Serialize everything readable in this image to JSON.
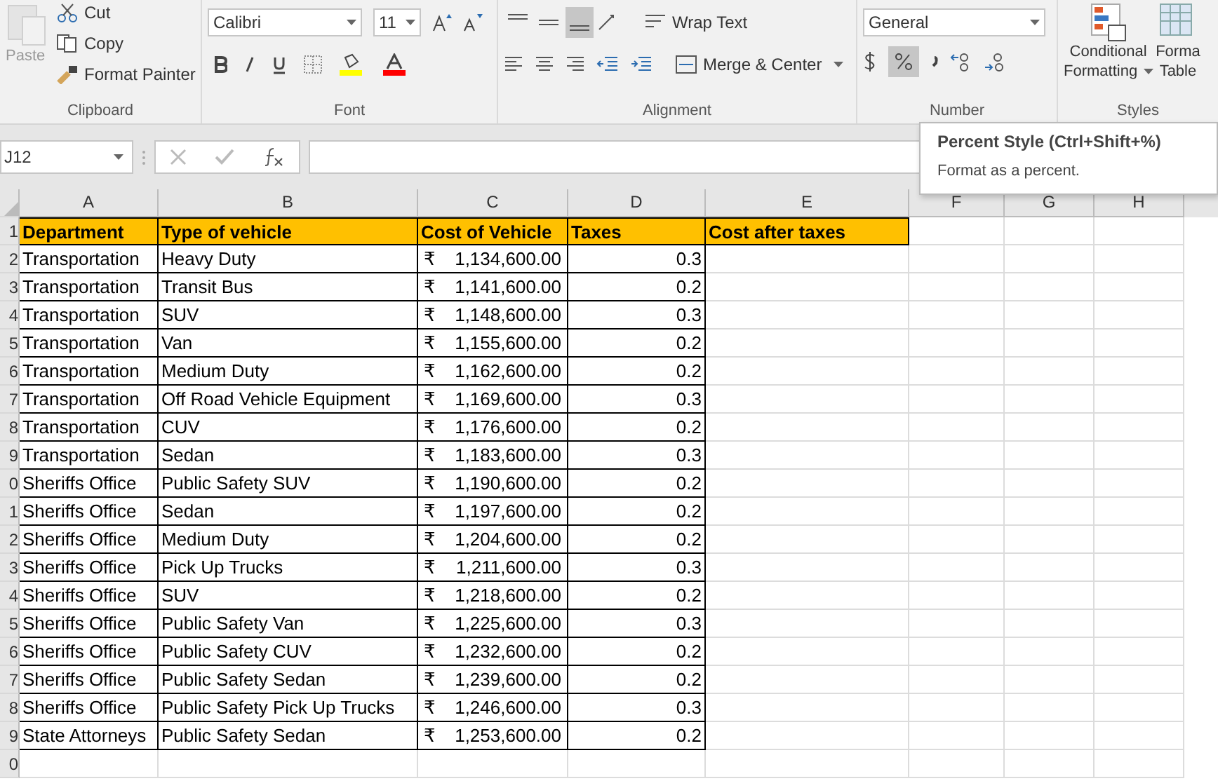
{
  "ribbon": {
    "clipboard": {
      "paste": "Paste",
      "cut": "Cut",
      "copy": "Copy",
      "format_painter": "Format Painter",
      "group_label": "Clipboard"
    },
    "font": {
      "font_name": "Calibri",
      "font_size": "11",
      "group_label": "Font"
    },
    "alignment": {
      "vertical_buttons": [
        {
          "selected": false
        },
        {
          "selected": false
        },
        {
          "selected": true
        }
      ],
      "wrap_text": "Wrap Text",
      "merge_center": "Merge & Center",
      "group_label": "Alignment"
    },
    "number": {
      "format": "General",
      "percent_highlighted": true,
      "group_label": "Number"
    },
    "styles": {
      "conditional": "Conditional",
      "conditional_2": "Formatting",
      "format_table": "Forma",
      "format_table_2": "Table",
      "group_label": "Styles"
    }
  },
  "formula_bar": {
    "name_box": "J12"
  },
  "tooltip": {
    "title": "Percent Style (Ctrl+Shift+%)",
    "text": "Format as a percent."
  },
  "sheet": {
    "columns": [
      "A",
      "B",
      "C",
      "D",
      "E",
      "F",
      "G",
      "H"
    ],
    "header_row": {
      "number": "1",
      "cells": [
        "Department",
        "Type of vehicle",
        "Cost of Vehicle",
        "Taxes",
        "Cost after taxes"
      ]
    },
    "rows": [
      {
        "number": "2",
        "cells": [
          "Transportation",
          "Heavy Duty",
          {
            "symbol": "₹",
            "amount": "1,134,600.00"
          },
          "0.3"
        ]
      },
      {
        "number": "3",
        "cells": [
          "Transportation",
          "Transit Bus",
          {
            "symbol": "₹",
            "amount": "1,141,600.00"
          },
          "0.2"
        ]
      },
      {
        "number": "4",
        "cells": [
          "Transportation",
          "SUV",
          {
            "symbol": "₹",
            "amount": "1,148,600.00"
          },
          "0.3"
        ]
      },
      {
        "number": "5",
        "cells": [
          "Transportation",
          "Van",
          {
            "symbol": "₹",
            "amount": "1,155,600.00"
          },
          "0.2"
        ]
      },
      {
        "number": "6",
        "cells": [
          "Transportation",
          "Medium Duty",
          {
            "symbol": "₹",
            "amount": "1,162,600.00"
          },
          "0.2"
        ]
      },
      {
        "number": "7",
        "cells": [
          "Transportation",
          "Off Road Vehicle Equipment",
          {
            "symbol": "₹",
            "amount": "1,169,600.00"
          },
          "0.3"
        ]
      },
      {
        "number": "8",
        "cells": [
          "Transportation",
          "CUV",
          {
            "symbol": "₹",
            "amount": "1,176,600.00"
          },
          "0.2"
        ]
      },
      {
        "number": "9",
        "cells": [
          "Transportation",
          "Sedan",
          {
            "symbol": "₹",
            "amount": "1,183,600.00"
          },
          "0.3"
        ]
      },
      {
        "number": "0",
        "cells": [
          "Sheriffs Office",
          "Public Safety SUV",
          {
            "symbol": "₹",
            "amount": "1,190,600.00"
          },
          "0.2"
        ]
      },
      {
        "number": "1",
        "cells": [
          "Sheriffs Office",
          "Sedan",
          {
            "symbol": "₹",
            "amount": "1,197,600.00"
          },
          "0.2"
        ]
      },
      {
        "number": "2",
        "cells": [
          "Sheriffs Office",
          "Medium Duty",
          {
            "symbol": "₹",
            "amount": "1,204,600.00"
          },
          "0.2"
        ]
      },
      {
        "number": "3",
        "cells": [
          "Sheriffs Office",
          "Pick Up Trucks",
          {
            "symbol": "₹",
            "amount": "1,211,600.00"
          },
          "0.3"
        ]
      },
      {
        "number": "4",
        "cells": [
          "Sheriffs Office",
          "SUV",
          {
            "symbol": "₹",
            "amount": "1,218,600.00"
          },
          "0.2"
        ]
      },
      {
        "number": "5",
        "cells": [
          "Sheriffs Office",
          "Public Safety Van",
          {
            "symbol": "₹",
            "amount": "1,225,600.00"
          },
          "0.3"
        ]
      },
      {
        "number": "6",
        "cells": [
          "Sheriffs Office",
          "Public Safety CUV",
          {
            "symbol": "₹",
            "amount": "1,232,600.00"
          },
          "0.2"
        ]
      },
      {
        "number": "7",
        "cells": [
          "Sheriffs Office",
          "Public Safety Sedan",
          {
            "symbol": "₹",
            "amount": "1,239,600.00"
          },
          "0.2"
        ]
      },
      {
        "number": "8",
        "cells": [
          "Sheriffs Office",
          "Public Safety Pick Up Trucks",
          {
            "symbol": "₹",
            "amount": "1,246,600.00"
          },
          "0.3"
        ]
      },
      {
        "number": "9",
        "cells": [
          "State Attorneys",
          "Public Safety Sedan",
          {
            "symbol": "₹",
            "amount": "1,253,600.00"
          },
          "0.2"
        ]
      }
    ],
    "empty_row": {
      "number": "0"
    }
  }
}
